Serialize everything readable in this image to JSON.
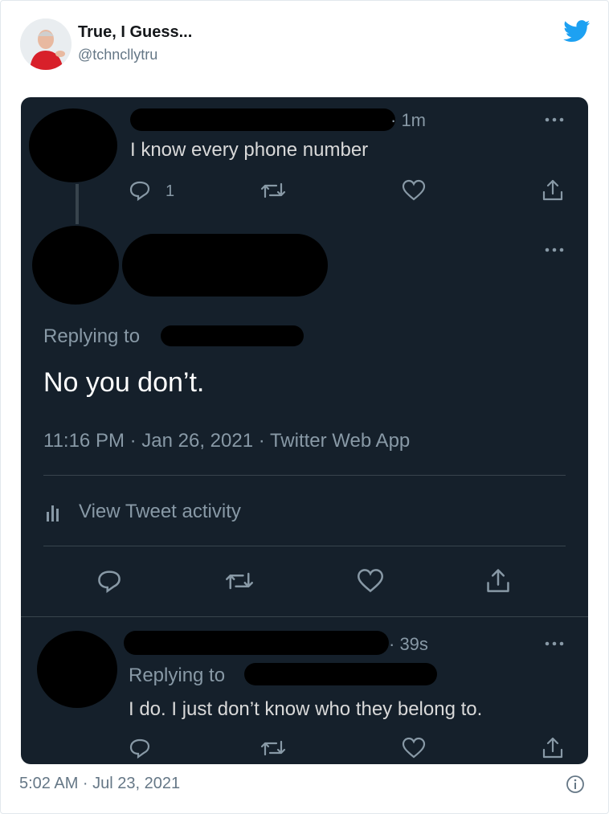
{
  "embed": {
    "author_name": "True, I Guess...",
    "author_handle": "@tchncllytru",
    "timestamp": "5:02 AM · Jul 23, 2021",
    "twitter_blue": "#1da1f2"
  },
  "screenshot": {
    "background": "#15202b",
    "first_tweet": {
      "time": "· 1m",
      "text": "I know every phone number",
      "reply_count": "1"
    },
    "main_tweet": {
      "replying_label": "Replying to",
      "text": "No you don’t.",
      "meta": "11:16 PM · Jan 26, 2021 · Twitter Web App",
      "activity_label": "View Tweet activity"
    },
    "reply_tweet": {
      "time": "· 39s",
      "replying_label": "Replying to",
      "text": "I do. I just don’t know who they belong to."
    }
  }
}
